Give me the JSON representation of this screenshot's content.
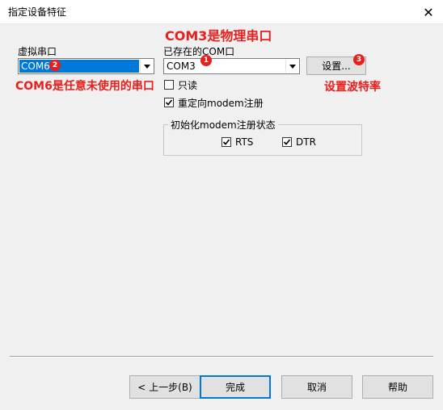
{
  "window": {
    "title": "指定设备特征",
    "close_glyph": "✕"
  },
  "virtual_port": {
    "label": "虚拟串口",
    "selected_value": "COM6"
  },
  "existing_port": {
    "label": "已存在的COM口",
    "selected_value": "COM3"
  },
  "settings_button": {
    "label": "设置..."
  },
  "readonly_checkbox": {
    "label": "只读",
    "checked": false
  },
  "redirect_checkbox": {
    "label": "重定向modem注册",
    "checked": true
  },
  "init_group": {
    "title": "初始化modem注册状态",
    "rts": {
      "label": "RTS",
      "checked": true
    },
    "dtr": {
      "label": "DTR",
      "checked": true
    }
  },
  "footer": {
    "back_label": "< 上一步(B)",
    "finish_label": "完成",
    "cancel_label": "取消",
    "help_label": "帮助"
  },
  "annotations": {
    "com3_note": "COM3是物理串口",
    "com6_note": "COM6是任意未使用的串口",
    "baud_note": "设置波特率",
    "badge1": "1",
    "badge2": "2",
    "badge3": "3",
    "color": "#e8201c"
  },
  "colors": {
    "selection": "#0078d7",
    "default_button_border": "#0078d7"
  }
}
